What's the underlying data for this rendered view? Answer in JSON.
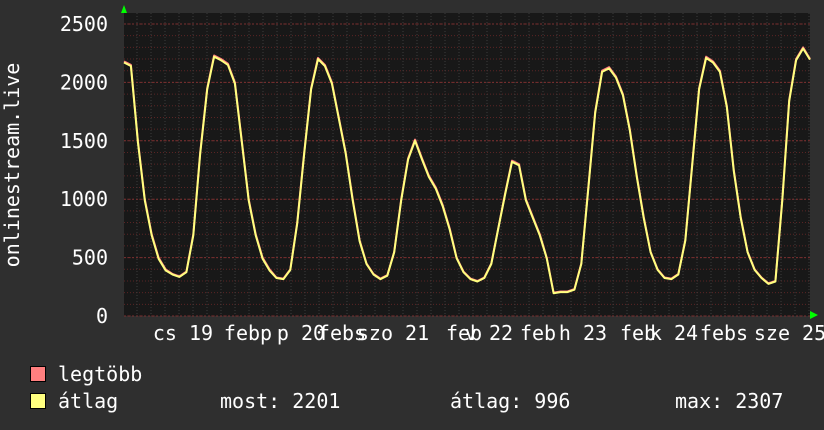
{
  "chart_data": {
    "type": "line",
    "ylabel": "onlinestream.live",
    "ylim": [
      0,
      2500
    ],
    "yticks": [
      0,
      500,
      1000,
      1500,
      2000,
      2500
    ],
    "grid": true,
    "x_tick_labels": [
      "cs 19",
      "febp",
      "p 20",
      "febs",
      "szo 21",
      "feb",
      "v 22",
      "feb",
      "h 23",
      "feb",
      "k 24",
      "febs",
      "sze 25"
    ],
    "series": [
      {
        "name": "legtöbb",
        "color": "#ff7f7f",
        "values": [
          2180,
          2150,
          1500,
          1000,
          700,
          500,
          400,
          360,
          340,
          380,
          700,
          1400,
          1950,
          2230,
          2200,
          2160,
          2000,
          1500,
          1000,
          700,
          500,
          400,
          330,
          320,
          400,
          800,
          1400,
          1950,
          2210,
          2150,
          2000,
          1700,
          1400,
          1000,
          650,
          450,
          360,
          320,
          350,
          550,
          1000,
          1350,
          1510,
          1350,
          1200,
          1100,
          950,
          750,
          500,
          380,
          320,
          300,
          330,
          450,
          750,
          1050,
          1330,
          1300,
          1000,
          850,
          700,
          500,
          200,
          210,
          210,
          230,
          450,
          1100,
          1750,
          2100,
          2130,
          2050,
          1900,
          1600,
          1200,
          850,
          550,
          400,
          330,
          320,
          360,
          650,
          1300,
          1950,
          2220,
          2180,
          2100,
          1800,
          1250,
          850,
          550,
          400,
          330,
          280,
          300,
          1000,
          1850,
          2200,
          2300,
          2201
        ]
      },
      {
        "name": "átlag",
        "color": "#ffff7f",
        "values": [
          2170,
          2140,
          1490,
          990,
          690,
          490,
          390,
          355,
          335,
          375,
          690,
          1390,
          1940,
          2220,
          2190,
          2150,
          1990,
          1490,
          990,
          690,
          490,
          390,
          325,
          315,
          395,
          790,
          1390,
          1940,
          2200,
          2140,
          1990,
          1690,
          1390,
          990,
          640,
          445,
          355,
          315,
          345,
          545,
          990,
          1340,
          1500,
          1340,
          1190,
          1090,
          940,
          740,
          495,
          375,
          315,
          295,
          325,
          445,
          745,
          1040,
          1320,
          1290,
          990,
          840,
          690,
          495,
          195,
          205,
          205,
          225,
          445,
          1090,
          1740,
          2090,
          2120,
          2040,
          1890,
          1590,
          1190,
          840,
          545,
          395,
          325,
          315,
          355,
          645,
          1290,
          1940,
          2210,
          2170,
          2090,
          1790,
          1240,
          840,
          545,
          395,
          325,
          275,
          295,
          990,
          1840,
          2190,
          2290,
          2195
        ]
      }
    ]
  },
  "legend": {
    "max_label": "legtöbb",
    "avg_label": "átlag",
    "max_color": "#ff7f7f",
    "avg_color": "#ffff7f"
  },
  "stats": {
    "most": "most: 2201",
    "atlag": "átlag: 996",
    "max": "max: 2307"
  }
}
